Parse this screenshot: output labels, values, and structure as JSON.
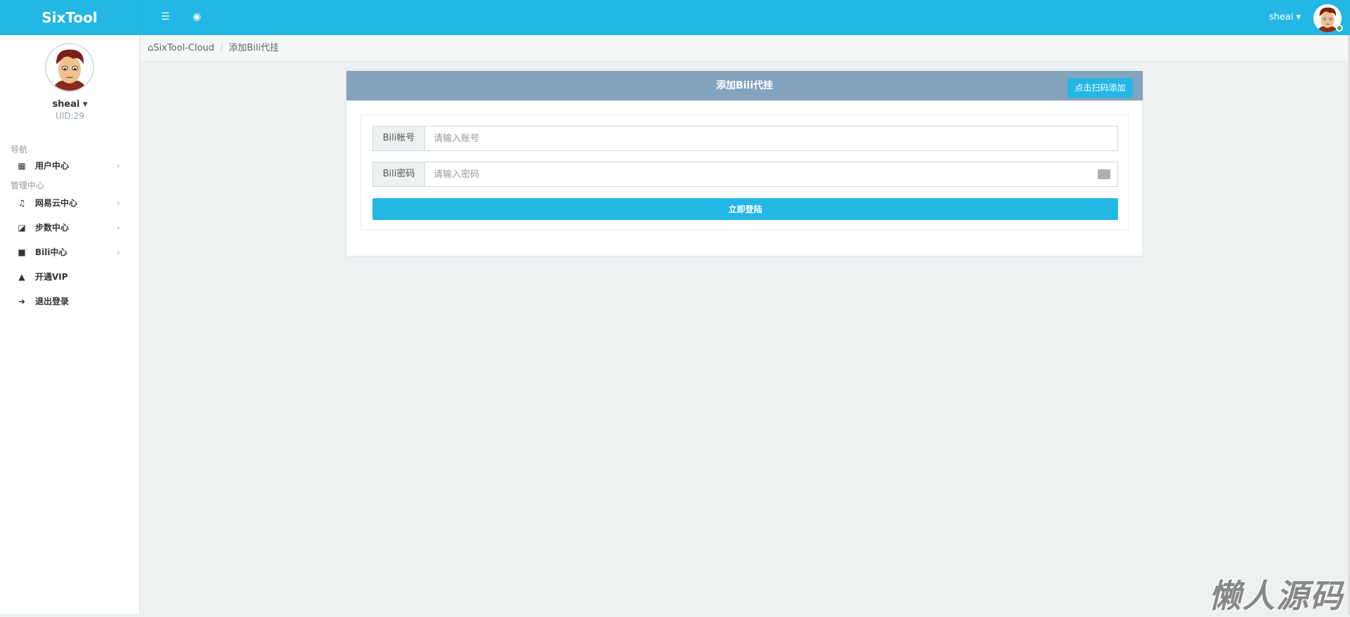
{
  "header": {
    "brand": "SixTool",
    "username": "sheai"
  },
  "sidebar": {
    "username": "sheai",
    "uid": "UID:29",
    "section_nav": "导航",
    "section_admin": "管理中心",
    "items": [
      {
        "label": "用户中心",
        "icon": "grid-icon"
      },
      {
        "label": "网易云中心",
        "icon": "music-icon"
      },
      {
        "label": "步数中心",
        "icon": "external-link-icon"
      },
      {
        "label": "Bili中心",
        "icon": "video-camera-icon"
      },
      {
        "label": "开通VIP",
        "icon": "shopping-bag-icon"
      },
      {
        "label": "退出登录",
        "icon": "sign-out-icon"
      }
    ]
  },
  "breadcrumb": {
    "home": "SixTool-Cloud",
    "current": "添加Bili代挂"
  },
  "card": {
    "title": "添加Bili代挂",
    "scan_button": "点击扫码添加",
    "account_label": "Bili帐号",
    "account_placeholder": "请输入账号",
    "password_label": "Bili密码",
    "password_placeholder": "请输入密码",
    "login_button": "立即登陆"
  },
  "watermark": "懒人源码",
  "colors": {
    "primary": "#23b7e5",
    "card_header": "#84a3bc",
    "online": "#27c24c"
  }
}
